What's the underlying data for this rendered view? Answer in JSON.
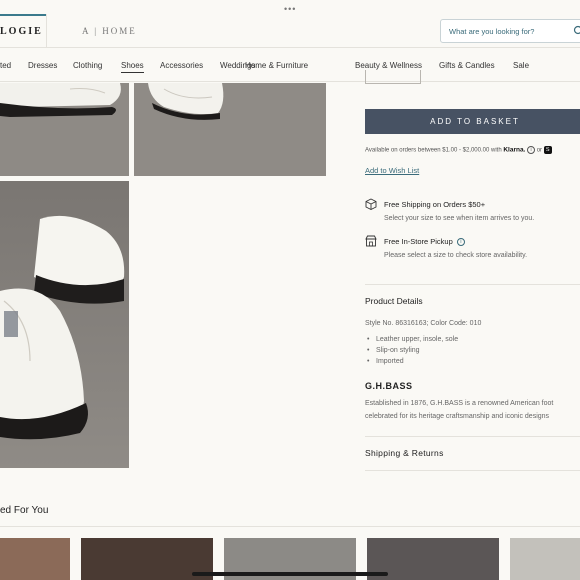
{
  "window": {
    "dots": "•••"
  },
  "header": {
    "brand": "LOGIE",
    "home_tab": "A | HOME",
    "search_placeholder": "What are you looking for?"
  },
  "nav": {
    "items": [
      {
        "label": "ted"
      },
      {
        "label": "Dresses"
      },
      {
        "label": "Clothing"
      },
      {
        "label": "Shoes"
      },
      {
        "label": "Accessories"
      },
      {
        "label": "Weddings"
      },
      {
        "label": "Home & Furniture"
      },
      {
        "label": "Beauty & Wellness"
      },
      {
        "label": "Gifts & Candles"
      },
      {
        "label": "Sale"
      }
    ],
    "active": "Shoes"
  },
  "purchase": {
    "add_to_basket": "ADD TO BASKET",
    "klarna_text": "Available on orders between $1.00 - $2,000.00 with",
    "klarna_brand": "Klarna.",
    "klarna_or": "or",
    "wishlist": "Add to Wish List"
  },
  "shipping": {
    "free_shipping_title": "Free Shipping on Orders $50+",
    "free_shipping_sub": "Select your size to see when item arrives to you.",
    "pickup_title": "Free In-Store Pickup",
    "pickup_sub": "Please select a size to check store availability."
  },
  "details": {
    "title": "Product Details",
    "style_no": "Style No. 86316163; Color Code: 010",
    "bullets": [
      "Leather upper, insole, sole",
      "Slip-on styling",
      "Imported"
    ],
    "brand_name": "G.H.BASS",
    "brand_desc_1": "Established in 1876, G.H.BASS is a renowned American foot",
    "brand_desc_2": "celebrated for its heritage craftsmanship and iconic designs"
  },
  "shipping_returns": "Shipping & Returns",
  "recommended": {
    "title": "ed For You"
  },
  "colors": {
    "button": "#475263",
    "link": "#3a6b7a",
    "accent_tab": "#3a7a8c",
    "background": "#faf9f5"
  }
}
